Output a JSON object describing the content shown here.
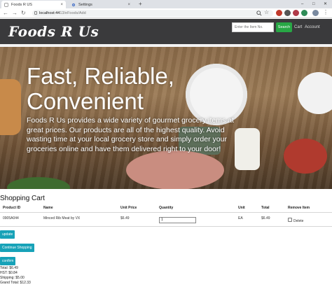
{
  "browser": {
    "tabs": [
      {
        "label": "Foods R US",
        "active": true
      },
      {
        "label": "Settings",
        "active": false
      }
    ],
    "url_host": "localhost:44",
    "url_path": "13/eFoods/Add",
    "window_controls": [
      "–",
      "□",
      "✕"
    ]
  },
  "header": {
    "logo": "Foods R Us",
    "search_placeholder": "Enter the Item No.",
    "search_button": "Search",
    "links": [
      "Cart",
      "Account"
    ]
  },
  "hero": {
    "title": "Fast, Reliable, Convenient",
    "text": "Foods R Us provides a wide variety of gourmet grocery items at great prices. Our products are all of the highest quality. Avoid wasting time at your local grocery store and simply order your groceries online and have them delivered right to your door!"
  },
  "cart": {
    "title": "Shopping Cart",
    "columns": [
      "Product ID",
      "Name",
      "Unit Price",
      "Quantity",
      "Unit",
      "Total",
      "Remove Item"
    ],
    "rows": [
      {
        "product_id": "0905A044",
        "name": "Minced Rib Meat by VX",
        "unit_price": "$6.49",
        "quantity": "1",
        "unit": "EA",
        "total": "$6.49",
        "remove_label": "Delete"
      }
    ],
    "buttons": {
      "update": "update",
      "continue": "Continue Shopping",
      "confirm": "confirm"
    },
    "totals": {
      "total": "Total: $6.49",
      "hst": "HST: $0.84",
      "shipping": "Shipping: $5.00",
      "grand_total": "Grand Total: $12.33"
    }
  },
  "colors": {
    "header_bg": "#3a3a3c",
    "search_button": "#28a745",
    "action_button": "#17a2b8"
  }
}
